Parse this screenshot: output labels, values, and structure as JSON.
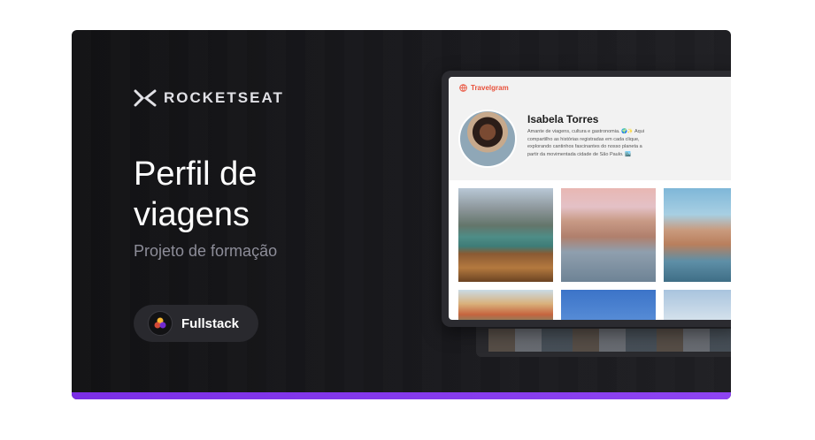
{
  "brand": {
    "name": "ROCKETSEAT"
  },
  "hero": {
    "title_line1": "Perfil de",
    "title_line2": "viagens",
    "subtitle": "Projeto de formação"
  },
  "badge": {
    "label": "Fullstack",
    "icon": "fullstack-icon"
  },
  "mockup": {
    "app_name": "Travelgram",
    "app_icon": "globe-icon",
    "profile": {
      "name": "Isabela Torres",
      "bio": "Amante de viagens, cultura e gastronomia. 🌍✨ Aqui compartilho as histórias registradas em cada clique, explorando cantinhos fascinantes do nosso planeta a partir da movimentada cidade de São Paulo. 🏙️"
    }
  },
  "colors": {
    "background": "#121214",
    "accent_bar": "#8e44f2",
    "app_brand": "#e8503a",
    "badge_bg": "#29292e"
  }
}
